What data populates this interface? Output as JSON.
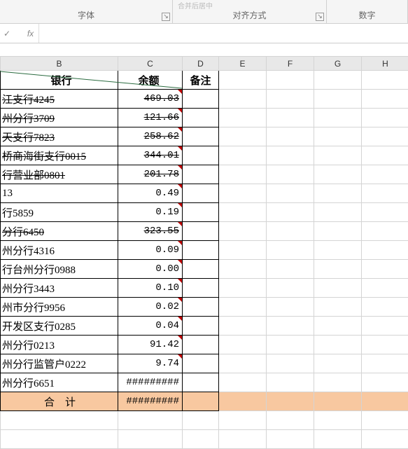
{
  "ribbon": {
    "font_group": "字体",
    "align_group": "对齐方式",
    "number_group": "数字",
    "merge_hint": "合并后居中"
  },
  "formula_bar": {
    "fn_label": "fx",
    "value": ""
  },
  "columns": [
    "B",
    "C",
    "D",
    "E",
    "F",
    "G",
    "H"
  ],
  "header": {
    "bank": "银行",
    "balance": "余额",
    "remark": "备注"
  },
  "rows": [
    {
      "bank": "江支行4245",
      "balance": "469.03",
      "strike": true,
      "comment": true
    },
    {
      "bank": "州分行3709",
      "balance": "121.66",
      "strike": true,
      "comment": true
    },
    {
      "bank": "天支行7823",
      "balance": "258.62",
      "strike": true,
      "comment": true
    },
    {
      "bank": "桥商海街支行0015",
      "balance": "344.01",
      "strike": true,
      "comment": true
    },
    {
      "bank": "行营业部0801",
      "balance": "201.78",
      "strike": true,
      "comment": true
    },
    {
      "bank": "13",
      "balance": "0.49",
      "strike": false,
      "comment": true
    },
    {
      "bank": "行5859",
      "balance": "0.19",
      "strike": false,
      "comment": true
    },
    {
      "bank": "分行6450",
      "balance": "323.55",
      "strike": true,
      "comment": true
    },
    {
      "bank": "州分行4316",
      "balance": "0.09",
      "strike": false,
      "comment": true
    },
    {
      "bank": "行台州分行0988",
      "balance": "0.00",
      "strike": false,
      "comment": true
    },
    {
      "bank": "州分行3443",
      "balance": "0.10",
      "strike": false,
      "comment": true
    },
    {
      "bank": "州市分行9956",
      "balance": "0.02",
      "strike": false,
      "comment": true
    },
    {
      "bank": "开发区支行0285",
      "balance": "0.04",
      "strike": false,
      "comment": true
    },
    {
      "bank": "州分行0213",
      "balance": "91.42",
      "strike": false,
      "comment": true
    },
    {
      "bank": "州分行监管户0222",
      "balance": "9.74",
      "strike": false,
      "comment": true
    },
    {
      "bank": "州分行6651",
      "balance": "#########",
      "strike": false,
      "comment": false
    }
  ],
  "total": {
    "label": "合　计",
    "value": "#########"
  },
  "chart_data": {
    "type": "table",
    "title": "银行余额",
    "columns": [
      "银行",
      "余额",
      "备注"
    ],
    "rows": [
      [
        "江支行4245",
        469.03,
        ""
      ],
      [
        "州分行3709",
        121.66,
        ""
      ],
      [
        "天支行7823",
        258.62,
        ""
      ],
      [
        "桥商海街支行0015",
        344.01,
        ""
      ],
      [
        "行营业部0801",
        201.78,
        ""
      ],
      [
        "13",
        0.49,
        ""
      ],
      [
        "行5859",
        0.19,
        ""
      ],
      [
        "分行6450",
        323.55,
        ""
      ],
      [
        "州分行4316",
        0.09,
        ""
      ],
      [
        "行台州分行0988",
        0.0,
        ""
      ],
      [
        "州分行3443",
        0.1,
        ""
      ],
      [
        "州市分行9956",
        0.02,
        ""
      ],
      [
        "开发区支行0285",
        0.04,
        ""
      ],
      [
        "州分行0213",
        91.42,
        ""
      ],
      [
        "州分行监管户0222",
        9.74,
        ""
      ],
      [
        "州分行6651",
        null,
        ""
      ]
    ],
    "total_label": "合 计",
    "total_value": null
  }
}
